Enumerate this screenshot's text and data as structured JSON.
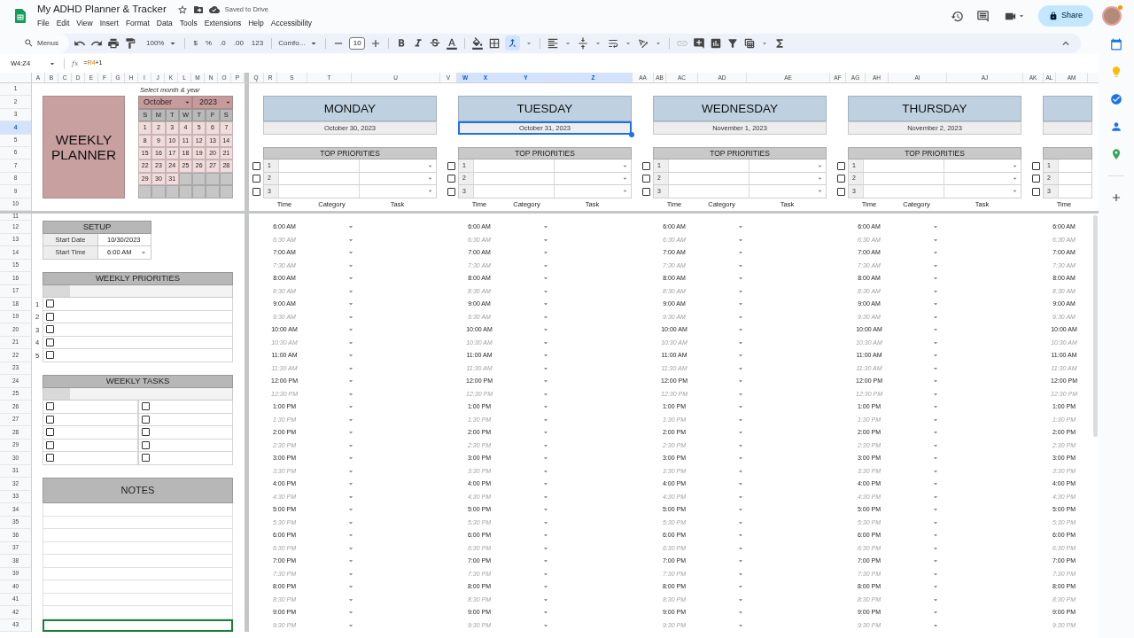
{
  "document": {
    "title": "My ADHD Planner & Tracker",
    "save_status": "Saved to Drive"
  },
  "menu": [
    "File",
    "Edit",
    "View",
    "Insert",
    "Format",
    "Data",
    "Tools",
    "Extensions",
    "Help",
    "Accessibility"
  ],
  "share_button": "Share",
  "toolbar": {
    "search": "Menus",
    "zoom": "100%",
    "currency": "$",
    "percent": "%",
    "decimal_decrease": ".0",
    "decimal_increase": ".00",
    "number_format": "123",
    "font": "Comfo...",
    "font_size": "10",
    "merge_selected": true,
    "link_disabled": true
  },
  "name_box": "W4:Z4",
  "function_label": "fx",
  "formula": [
    {
      "text": "=",
      "kind": "plain"
    },
    {
      "text": "R4",
      "kind": "ref"
    },
    {
      "text": "+1",
      "kind": "plain"
    }
  ],
  "columns": [
    {
      "label": "A",
      "selected": false
    },
    {
      "label": "B",
      "selected": false
    },
    {
      "label": "C",
      "selected": false
    },
    {
      "label": "D",
      "selected": false
    },
    {
      "label": "E",
      "selected": false
    },
    {
      "label": "F",
      "selected": false
    },
    {
      "label": "G",
      "selected": false
    },
    {
      "label": "H",
      "selected": false
    },
    {
      "label": "I",
      "selected": false
    },
    {
      "label": "J",
      "selected": false
    },
    {
      "label": "K",
      "selected": false
    },
    {
      "label": "L",
      "selected": false
    },
    {
      "label": "M",
      "selected": false
    },
    {
      "label": "N",
      "selected": false
    },
    {
      "label": "O",
      "selected": false
    },
    {
      "label": "P",
      "selected": false
    },
    {
      "label": "Q",
      "selected": false
    },
    {
      "label": "R",
      "selected": false
    },
    {
      "label": "S",
      "selected": false
    },
    {
      "label": "T",
      "selected": false
    },
    {
      "label": "U",
      "selected": false
    },
    {
      "label": "V",
      "selected": false
    },
    {
      "label": "W",
      "selected": true
    },
    {
      "label": "X",
      "selected": true
    },
    {
      "label": "Y",
      "selected": true
    },
    {
      "label": "Z",
      "selected": true
    },
    {
      "label": "AA",
      "selected": false
    },
    {
      "label": "AB",
      "selected": false
    },
    {
      "label": "AC",
      "selected": false
    },
    {
      "label": "AD",
      "selected": false
    },
    {
      "label": "AE",
      "selected": false
    },
    {
      "label": "AF",
      "selected": false
    },
    {
      "label": "AG",
      "selected": false
    },
    {
      "label": "AH",
      "selected": false
    },
    {
      "label": "AI",
      "selected": false
    },
    {
      "label": "AJ",
      "selected": false
    },
    {
      "label": "AK",
      "selected": false
    },
    {
      "label": "AL",
      "selected": false
    },
    {
      "label": "AM",
      "selected": false
    }
  ],
  "rows": [
    {
      "label": "1",
      "selected": false
    },
    {
      "label": "2",
      "selected": false
    },
    {
      "label": "3",
      "selected": false
    },
    {
      "label": "4",
      "selected": true
    },
    {
      "label": "5",
      "selected": false
    },
    {
      "label": "6",
      "selected": false
    },
    {
      "label": "7",
      "selected": false
    },
    {
      "label": "8",
      "selected": false
    },
    {
      "label": "9",
      "selected": false
    },
    {
      "label": "10",
      "selected": false
    },
    {
      "label": "11",
      "selected": false
    },
    {
      "label": "12",
      "selected": false
    },
    {
      "label": "13",
      "selected": false
    },
    {
      "label": "14",
      "selected": false
    },
    {
      "label": "15",
      "selected": false
    },
    {
      "label": "16",
      "selected": false
    },
    {
      "label": "17",
      "selected": false
    },
    {
      "label": "18",
      "selected": false
    },
    {
      "label": "19",
      "selected": false
    },
    {
      "label": "20",
      "selected": false
    },
    {
      "label": "21",
      "selected": false
    },
    {
      "label": "22",
      "selected": false
    },
    {
      "label": "23",
      "selected": false
    },
    {
      "label": "24",
      "selected": false
    },
    {
      "label": "25",
      "selected": false
    },
    {
      "label": "26",
      "selected": false
    },
    {
      "label": "27",
      "selected": false
    },
    {
      "label": "28",
      "selected": false
    },
    {
      "label": "29",
      "selected": false
    },
    {
      "label": "30",
      "selected": false
    },
    {
      "label": "31",
      "selected": false
    },
    {
      "label": "32",
      "selected": false
    },
    {
      "label": "33",
      "selected": false
    },
    {
      "label": "34",
      "selected": false
    },
    {
      "label": "35",
      "selected": false
    },
    {
      "label": "36",
      "selected": false
    },
    {
      "label": "37",
      "selected": false
    },
    {
      "label": "38",
      "selected": false
    },
    {
      "label": "39",
      "selected": false
    },
    {
      "label": "40",
      "selected": false
    },
    {
      "label": "41",
      "selected": false
    },
    {
      "label": "42",
      "selected": false
    },
    {
      "label": "43",
      "selected": false
    }
  ],
  "planner_title": "WEEKLY PLANNER",
  "calendar": {
    "hint": "Select month & year",
    "month": "October",
    "year": "2023",
    "weekdays": [
      "S",
      "M",
      "T",
      "W",
      "T",
      "F",
      "S"
    ],
    "weeks": [
      [
        "1",
        "2",
        "3",
        "4",
        "5",
        "6",
        "7"
      ],
      [
        "8",
        "9",
        "10",
        "11",
        "12",
        "13",
        "14"
      ],
      [
        "15",
        "16",
        "17",
        "18",
        "19",
        "20",
        "21"
      ],
      [
        "22",
        "23",
        "24",
        "25",
        "26",
        "27",
        "28"
      ],
      [
        "29",
        "30",
        "31"
      ]
    ]
  },
  "setup": {
    "title": "SETUP",
    "fields": [
      {
        "label": "Start Date",
        "value": "10/30/2023",
        "dropdown": false
      },
      {
        "label": "Start Time",
        "value": "6:00 AM",
        "dropdown": true
      }
    ]
  },
  "weekly_priorities": {
    "title": "WEEKLY PRIORITIES",
    "items": [
      {
        "number": "1",
        "checked": false
      },
      {
        "number": "2",
        "checked": false
      },
      {
        "number": "3",
        "checked": false
      },
      {
        "number": "4",
        "checked": false
      },
      {
        "number": "5",
        "checked": false
      }
    ]
  },
  "weekly_tasks": {
    "title": "WEEKLY TASKS",
    "items": [
      {
        "checked": false
      },
      {
        "checked": false
      },
      {
        "checked": false
      },
      {
        "checked": false
      },
      {
        "checked": false
      },
      {
        "checked": false
      },
      {
        "checked": false
      },
      {
        "checked": false
      },
      {
        "checked": false
      },
      {
        "checked": false
      }
    ]
  },
  "notes": {
    "title": "NOTES",
    "lines": [
      {
        "selected": false
      },
      {
        "selected": false
      },
      {
        "selected": false
      },
      {
        "selected": false
      },
      {
        "selected": false
      },
      {
        "selected": false
      },
      {
        "selected": false
      },
      {
        "selected": false
      },
      {
        "selected": false
      },
      {
        "selected": true
      }
    ]
  },
  "days": [
    {
      "kind": "full",
      "name": "MONDAY",
      "date": "October 30, 2023",
      "date_selected": false,
      "priorities_title": "TOP PRIORITIES",
      "priorities": [
        {
          "number": "1",
          "checked": false
        },
        {
          "number": "2",
          "checked": false
        },
        {
          "number": "3",
          "checked": false
        }
      ],
      "headers": [
        "Time",
        "Category",
        "Task"
      ],
      "slots": [
        {
          "time": "6:00 AM",
          "minor": false
        },
        {
          "time": "6:30 AM",
          "minor": true
        },
        {
          "time": "7:00 AM",
          "minor": false
        },
        {
          "time": "7:30 AM",
          "minor": true
        },
        {
          "time": "8:00 AM",
          "minor": false
        },
        {
          "time": "8:30 AM",
          "minor": true
        },
        {
          "time": "9:00 AM",
          "minor": false
        },
        {
          "time": "9:30 AM",
          "minor": true
        },
        {
          "time": "10:00 AM",
          "minor": false
        },
        {
          "time": "10:30 AM",
          "minor": true
        },
        {
          "time": "11:00 AM",
          "minor": false
        },
        {
          "time": "11:30 AM",
          "minor": true
        },
        {
          "time": "12:00 PM",
          "minor": false
        },
        {
          "time": "12:30 PM",
          "minor": true
        },
        {
          "time": "1:00 PM",
          "minor": false
        },
        {
          "time": "1:30 PM",
          "minor": true
        },
        {
          "time": "2:00 PM",
          "minor": false
        },
        {
          "time": "2:30 PM",
          "minor": true
        },
        {
          "time": "3:00 PM",
          "minor": false
        },
        {
          "time": "3:30 PM",
          "minor": true
        },
        {
          "time": "4:00 PM",
          "minor": false
        },
        {
          "time": "4:30 PM",
          "minor": true
        },
        {
          "time": "5:00 PM",
          "minor": false
        },
        {
          "time": "5:30 PM",
          "minor": true
        },
        {
          "time": "6:00 PM",
          "minor": false
        },
        {
          "time": "6:30 PM",
          "minor": true
        },
        {
          "time": "7:00 PM",
          "minor": false
        },
        {
          "time": "7:30 PM",
          "minor": true
        },
        {
          "time": "8:00 PM",
          "minor": false
        },
        {
          "time": "8:30 PM",
          "minor": true
        },
        {
          "time": "9:00 PM",
          "minor": false
        },
        {
          "time": "9:30 PM",
          "minor": true
        }
      ]
    },
    {
      "kind": "full",
      "name": "TUESDAY",
      "date": "October 31, 2023",
      "date_selected": true,
      "priorities_title": "TOP PRIORITIES",
      "priorities": [
        {
          "number": "1",
          "checked": false
        },
        {
          "number": "2",
          "checked": false
        },
        {
          "number": "3",
          "checked": false
        }
      ],
      "headers": [
        "Time",
        "Category",
        "Task"
      ],
      "slots": [
        {
          "time": "6:00 AM",
          "minor": false
        },
        {
          "time": "6:30 AM",
          "minor": true
        },
        {
          "time": "7:00 AM",
          "minor": false
        },
        {
          "time": "7:30 AM",
          "minor": true
        },
        {
          "time": "8:00 AM",
          "minor": false
        },
        {
          "time": "8:30 AM",
          "minor": true
        },
        {
          "time": "9:00 AM",
          "minor": false
        },
        {
          "time": "9:30 AM",
          "minor": true
        },
        {
          "time": "10:00 AM",
          "minor": false
        },
        {
          "time": "10:30 AM",
          "minor": true
        },
        {
          "time": "11:00 AM",
          "minor": false
        },
        {
          "time": "11:30 AM",
          "minor": true
        },
        {
          "time": "12:00 PM",
          "minor": false
        },
        {
          "time": "12:30 PM",
          "minor": true
        },
        {
          "time": "1:00 PM",
          "minor": false
        },
        {
          "time": "1:30 PM",
          "minor": true
        },
        {
          "time": "2:00 PM",
          "minor": false
        },
        {
          "time": "2:30 PM",
          "minor": true
        },
        {
          "time": "3:00 PM",
          "minor": false
        },
        {
          "time": "3:30 PM",
          "minor": true
        },
        {
          "time": "4:00 PM",
          "minor": false
        },
        {
          "time": "4:30 PM",
          "minor": true
        },
        {
          "time": "5:00 PM",
          "minor": false
        },
        {
          "time": "5:30 PM",
          "minor": true
        },
        {
          "time": "6:00 PM",
          "minor": false
        },
        {
          "time": "6:30 PM",
          "minor": true
        },
        {
          "time": "7:00 PM",
          "minor": false
        },
        {
          "time": "7:30 PM",
          "minor": true
        },
        {
          "time": "8:00 PM",
          "minor": false
        },
        {
          "time": "8:30 PM",
          "minor": true
        },
        {
          "time": "9:00 PM",
          "minor": false
        },
        {
          "time": "9:30 PM",
          "minor": true
        }
      ]
    },
    {
      "kind": "full",
      "name": "WEDNESDAY",
      "date": "November 1, 2023",
      "date_selected": false,
      "priorities_title": "TOP PRIORITIES",
      "priorities": [
        {
          "number": "1",
          "checked": false
        },
        {
          "number": "2",
          "checked": false
        },
        {
          "number": "3",
          "checked": false
        }
      ],
      "headers": [
        "Time",
        "Category",
        "Task"
      ],
      "slots": [
        {
          "time": "6:00 AM",
          "minor": false
        },
        {
          "time": "6:30 AM",
          "minor": true
        },
        {
          "time": "7:00 AM",
          "minor": false
        },
        {
          "time": "7:30 AM",
          "minor": true
        },
        {
          "time": "8:00 AM",
          "minor": false
        },
        {
          "time": "8:30 AM",
          "minor": true
        },
        {
          "time": "9:00 AM",
          "minor": false
        },
        {
          "time": "9:30 AM",
          "minor": true
        },
        {
          "time": "10:00 AM",
          "minor": false
        },
        {
          "time": "10:30 AM",
          "minor": true
        },
        {
          "time": "11:00 AM",
          "minor": false
        },
        {
          "time": "11:30 AM",
          "minor": true
        },
        {
          "time": "12:00 PM",
          "minor": false
        },
        {
          "time": "12:30 PM",
          "minor": true
        },
        {
          "time": "1:00 PM",
          "minor": false
        },
        {
          "time": "1:30 PM",
          "minor": true
        },
        {
          "time": "2:00 PM",
          "minor": false
        },
        {
          "time": "2:30 PM",
          "minor": true
        },
        {
          "time": "3:00 PM",
          "minor": false
        },
        {
          "time": "3:30 PM",
          "minor": true
        },
        {
          "time": "4:00 PM",
          "minor": false
        },
        {
          "time": "4:30 PM",
          "minor": true
        },
        {
          "time": "5:00 PM",
          "minor": false
        },
        {
          "time": "5:30 PM",
          "minor": true
        },
        {
          "time": "6:00 PM",
          "minor": false
        },
        {
          "time": "6:30 PM",
          "minor": true
        },
        {
          "time": "7:00 PM",
          "minor": false
        },
        {
          "time": "7:30 PM",
          "minor": true
        },
        {
          "time": "8:00 PM",
          "minor": false
        },
        {
          "time": "8:30 PM",
          "minor": true
        },
        {
          "time": "9:00 PM",
          "minor": false
        },
        {
          "time": "9:30 PM",
          "minor": true
        }
      ]
    },
    {
      "kind": "full",
      "name": "THURSDAY",
      "date": "November 2, 2023",
      "date_selected": false,
      "priorities_title": "TOP PRIORITIES",
      "priorities": [
        {
          "number": "1",
          "checked": false
        },
        {
          "number": "2",
          "checked": false
        },
        {
          "number": "3",
          "checked": false
        }
      ],
      "headers": [
        "Time",
        "Category",
        "Task"
      ],
      "slots": [
        {
          "time": "6:00 AM",
          "minor": false
        },
        {
          "time": "6:30 AM",
          "minor": true
        },
        {
          "time": "7:00 AM",
          "minor": false
        },
        {
          "time": "7:30 AM",
          "minor": true
        },
        {
          "time": "8:00 AM",
          "minor": false
        },
        {
          "time": "8:30 AM",
          "minor": true
        },
        {
          "time": "9:00 AM",
          "minor": false
        },
        {
          "time": "9:30 AM",
          "minor": true
        },
        {
          "time": "10:00 AM",
          "minor": false
        },
        {
          "time": "10:30 AM",
          "minor": true
        },
        {
          "time": "11:00 AM",
          "minor": false
        },
        {
          "time": "11:30 AM",
          "minor": true
        },
        {
          "time": "12:00 PM",
          "minor": false
        },
        {
          "time": "12:30 PM",
          "minor": true
        },
        {
          "time": "1:00 PM",
          "minor": false
        },
        {
          "time": "1:30 PM",
          "minor": true
        },
        {
          "time": "2:00 PM",
          "minor": false
        },
        {
          "time": "2:30 PM",
          "minor": true
        },
        {
          "time": "3:00 PM",
          "minor": false
        },
        {
          "time": "3:30 PM",
          "minor": true
        },
        {
          "time": "4:00 PM",
          "minor": false
        },
        {
          "time": "4:30 PM",
          "minor": true
        },
        {
          "time": "5:00 PM",
          "minor": false
        },
        {
          "time": "5:30 PM",
          "minor": true
        },
        {
          "time": "6:00 PM",
          "minor": false
        },
        {
          "time": "6:30 PM",
          "minor": true
        },
        {
          "time": "7:00 PM",
          "minor": false
        },
        {
          "time": "7:30 PM",
          "minor": true
        },
        {
          "time": "8:00 PM",
          "minor": false
        },
        {
          "time": "8:30 PM",
          "minor": true
        },
        {
          "time": "9:00 PM",
          "minor": false
        },
        {
          "time": "9:30 PM",
          "minor": true
        }
      ]
    },
    {
      "kind": "partial",
      "date_selected": false,
      "priorities": [
        {
          "number": "1",
          "checked": false
        },
        {
          "number": "2",
          "checked": false
        },
        {
          "number": "3",
          "checked": false
        }
      ],
      "headers": [
        "Time"
      ],
      "slots": [
        {
          "time": "6:00 AM",
          "minor": false
        },
        {
          "time": "6:30 AM",
          "minor": true
        },
        {
          "time": "7:00 AM",
          "minor": false
        },
        {
          "time": "7:30 AM",
          "minor": true
        },
        {
          "time": "8:00 AM",
          "minor": false
        },
        {
          "time": "8:30 AM",
          "minor": true
        },
        {
          "time": "9:00 AM",
          "minor": false
        },
        {
          "time": "9:30 AM",
          "minor": true
        },
        {
          "time": "10:00 AM",
          "minor": false
        },
        {
          "time": "10:30 AM",
          "minor": true
        },
        {
          "time": "11:00 AM",
          "minor": false
        },
        {
          "time": "11:30 AM",
          "minor": true
        },
        {
          "time": "12:00 PM",
          "minor": false
        },
        {
          "time": "12:30 PM",
          "minor": true
        },
        {
          "time": "1:00 PM",
          "minor": false
        },
        {
          "time": "1:30 PM",
          "minor": true
        },
        {
          "time": "2:00 PM",
          "minor": false
        },
        {
          "time": "2:30 PM",
          "minor": true
        },
        {
          "time": "3:00 PM",
          "minor": false
        },
        {
          "time": "3:30 PM",
          "minor": true
        },
        {
          "time": "4:00 PM",
          "minor": false
        },
        {
          "time": "4:30 PM",
          "minor": true
        },
        {
          "time": "5:00 PM",
          "minor": false
        },
        {
          "time": "5:30 PM",
          "minor": true
        },
        {
          "time": "6:00 PM",
          "minor": false
        },
        {
          "time": "6:30 PM",
          "minor": true
        },
        {
          "time": "7:00 PM",
          "minor": false
        },
        {
          "time": "7:30 PM",
          "minor": true
        },
        {
          "time": "8:00 PM",
          "minor": false
        },
        {
          "time": "8:30 PM",
          "minor": true
        },
        {
          "time": "9:00 PM",
          "minor": false
        },
        {
          "time": "9:30 PM",
          "minor": true
        }
      ]
    }
  ]
}
